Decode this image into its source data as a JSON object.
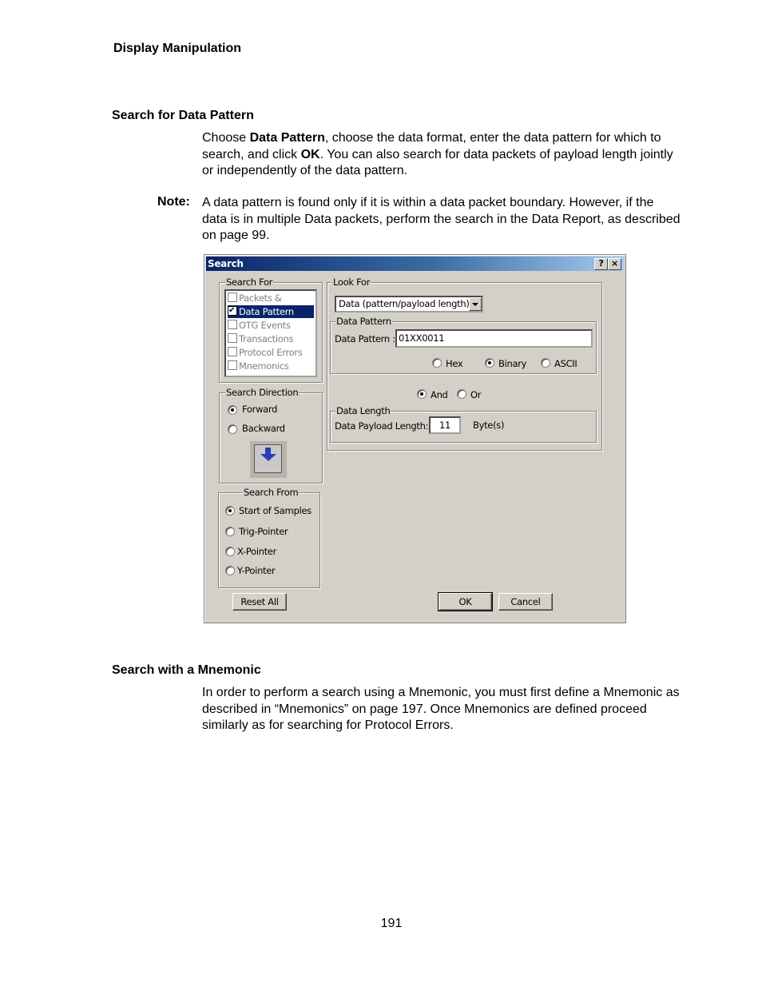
{
  "page": {
    "running_header": "Display Manipulation",
    "section1": {
      "heading": "Search for Data Pattern",
      "para_parts": [
        {
          "t": "Choose ",
          "b": false
        },
        {
          "t": "Data Pattern",
          "b": true
        },
        {
          "t": ", choose the data format, enter the data pattern for which to search, and click ",
          "b": false
        },
        {
          "t": "OK",
          "b": true
        },
        {
          "t": ". You can also search for data packets of payload length jointly or independently of the data pattern.",
          "b": false
        }
      ],
      "note_label": "Note:",
      "note_text": "A data pattern is found only if it is within a data packet boundary. However, if the data is in multiple Data packets, perform the search in the Data Report, as described on page 99."
    },
    "section2": {
      "heading": "Search with a Mnemonic",
      "para": "In order to perform a search using a Mnemonic, you must first define a Mnemonic as described in “Mnemonics” on page 197. Once Mnemonics are defined proceed similarly as for searching for Protocol Errors."
    },
    "page_number": "191"
  },
  "dialog": {
    "title": "Search",
    "help_button": "?",
    "close_button": "×",
    "search_for": {
      "legend": "Search For",
      "items": [
        {
          "label": "Packets & Events",
          "checked": false,
          "selected": false
        },
        {
          "label": "Data Pattern",
          "checked": true,
          "selected": true
        },
        {
          "label": "OTG Events",
          "checked": false,
          "selected": false
        },
        {
          "label": "Transactions",
          "checked": false,
          "selected": false
        },
        {
          "label": "Protocol Errors",
          "checked": false,
          "selected": false
        },
        {
          "label": "Mnemonics",
          "checked": false,
          "selected": false
        }
      ]
    },
    "search_direction": {
      "legend": "Search Direction",
      "options": [
        {
          "label": "Forward",
          "selected": true
        },
        {
          "label": "Backward",
          "selected": false
        }
      ],
      "icon": "arrow-down-icon"
    },
    "search_from": {
      "legend": "Search From",
      "options": [
        {
          "label": "Start of Samples",
          "selected": true
        },
        {
          "label": "Trig-Pointer",
          "selected": false
        },
        {
          "label": "X-Pointer",
          "selected": false
        },
        {
          "label": "Y-Pointer",
          "selected": false
        }
      ]
    },
    "look_for": {
      "legend": "Look For",
      "combo_value": "Data (pattern/payload length)",
      "data_pattern": {
        "legend": "Data Pattern",
        "label": "Data Pattern :",
        "value": "01XX0011",
        "formats": [
          {
            "label": "Hex",
            "selected": false
          },
          {
            "label": "Binary",
            "selected": true
          },
          {
            "label": "ASCII",
            "selected": false
          }
        ]
      },
      "logic": [
        {
          "label": "And",
          "selected": true
        },
        {
          "label": "Or",
          "selected": false
        }
      ],
      "data_length": {
        "legend": "Data Length",
        "label": "Data Payload Length:",
        "value": "11",
        "unit": "Byte(s)"
      }
    },
    "buttons": {
      "reset": "Reset All",
      "ok": "OK",
      "cancel": "Cancel"
    }
  }
}
